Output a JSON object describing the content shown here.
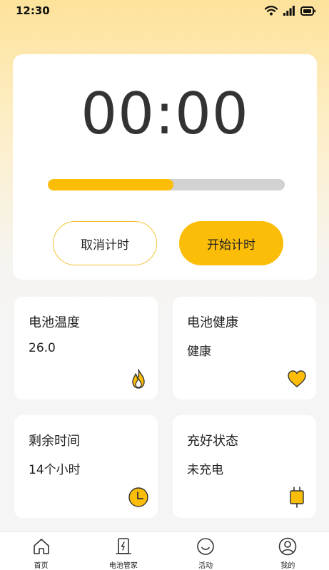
{
  "status_bar": {
    "time": "12:30",
    "icons": [
      "wifi-icon",
      "signal-icon",
      "battery-icon"
    ]
  },
  "timer": {
    "display": "00:00",
    "progress": 0.53,
    "cancel_label": "取消计时",
    "start_label": "开始计时"
  },
  "cards": [
    {
      "title": "电池温度",
      "value": "26.0",
      "icon": "fire-icon"
    },
    {
      "title": "电池健康",
      "value": "健康",
      "icon": "heart-icon"
    },
    {
      "title": "剩余时间",
      "value": "14个小时",
      "icon": "clock-icon"
    },
    {
      "title": "充好状态",
      "value": "未充电",
      "icon": "plug-icon"
    }
  ],
  "tabs": [
    {
      "label": "首页",
      "icon": "home-icon"
    },
    {
      "label": "电池管家",
      "icon": "battery-manager-icon"
    },
    {
      "label": "活动",
      "icon": "smile-icon"
    },
    {
      "label": "我的",
      "icon": "profile-icon"
    }
  ],
  "colors": {
    "accent": "#fbbd08",
    "track": "#d2d2d2",
    "icon_outline": "#333333"
  }
}
